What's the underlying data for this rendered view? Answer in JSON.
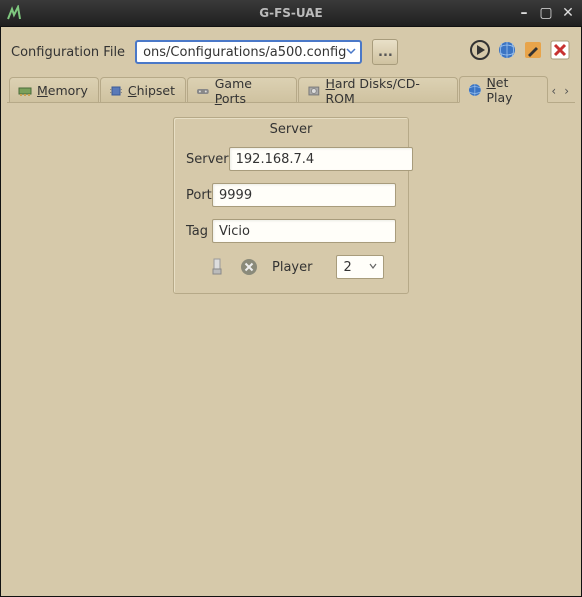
{
  "window": {
    "title": "G-FS-UAE"
  },
  "toolbar": {
    "config_label": "Configuration File",
    "config_path": "ons/Configurations/a500.config"
  },
  "tabs": {
    "memory_prefix": "M",
    "memory_rest": "emory",
    "chipset_prefix": "C",
    "chipset_rest": "hipset",
    "gameports_pre": "Game ",
    "gameports_u": "P",
    "gameports_post": "orts",
    "harddisks_prefix": "H",
    "harddisks_rest": "ard Disks/CD-ROM",
    "netplay_prefix": "N",
    "netplay_rest": "et Play"
  },
  "panel": {
    "title": "Server",
    "server_label": "Server",
    "server_value": "192.168.7.4",
    "port_label": "Port",
    "port_value": "9999",
    "tag_label": "Tag",
    "tag_value": "Vicio",
    "player_label": "Player",
    "player_value": "2"
  }
}
